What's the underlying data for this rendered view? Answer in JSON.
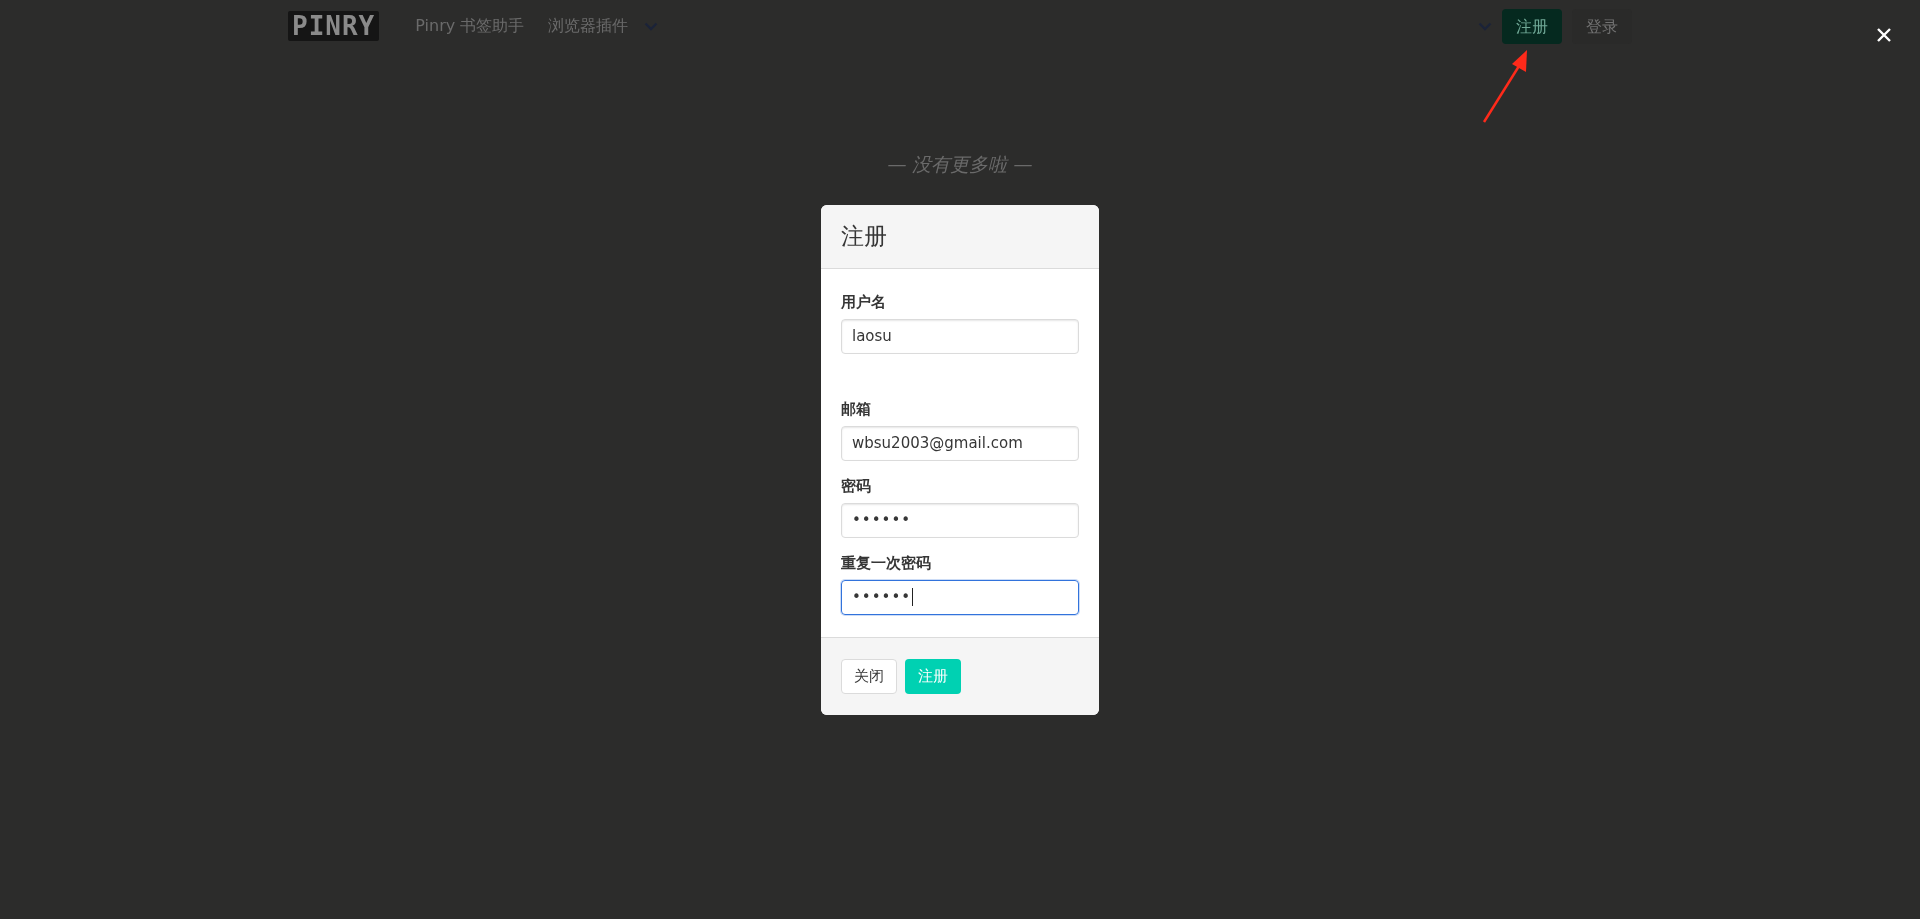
{
  "navbar": {
    "brand": "PINRY",
    "start": [
      {
        "kind": "link",
        "label": "Pinry 书签助手"
      },
      {
        "kind": "dropdown",
        "label": "浏览器插件"
      }
    ],
    "end": [
      {
        "kind": "dropdown"
      },
      {
        "kind": "button",
        "label": "注册",
        "primary": true
      },
      {
        "kind": "button",
        "label": "登录",
        "primary": false
      }
    ]
  },
  "end_message": "— 没有更多啦 —",
  "modal": {
    "title": "注册",
    "fields": [
      {
        "label": "用户名",
        "kind": "text",
        "value": "laosu",
        "focused": false
      },
      {
        "label": "邮箱",
        "kind": "text",
        "value": "wbsu2003@gmail.com",
        "focused": false
      },
      {
        "label": "密码",
        "kind": "password",
        "value": "••••••",
        "focused": false
      },
      {
        "label": "重复一次密码",
        "kind": "password",
        "value": "••••••",
        "focused": true
      }
    ],
    "buttons": [
      {
        "label": "关闭",
        "primary": false
      },
      {
        "label": "注册",
        "primary": true
      }
    ]
  }
}
